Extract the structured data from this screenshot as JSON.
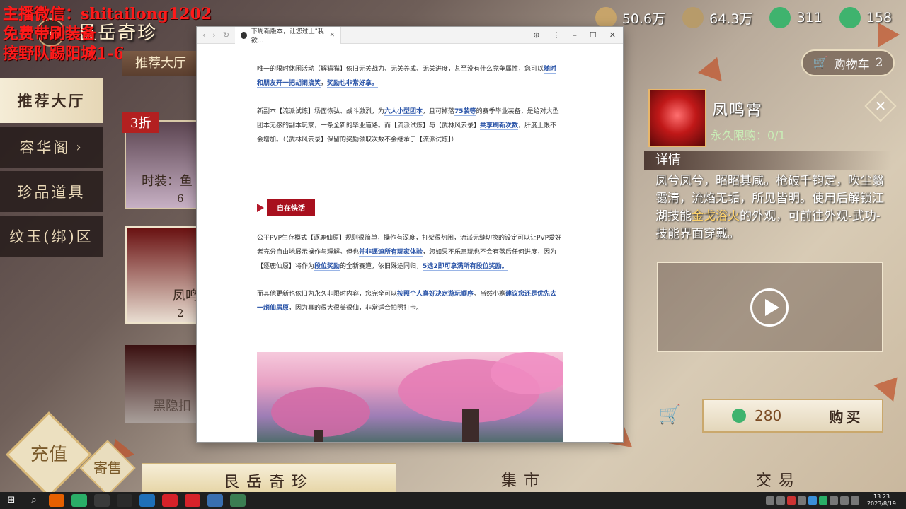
{
  "overlay": {
    "line1": "主播微信：shitailong1202",
    "line2": "免费带刷装备",
    "line3": "接野队踢阳城1-6"
  },
  "header": {
    "back_icon": "back-arrow-icon",
    "title": "艮岳奇珍"
  },
  "resources": [
    {
      "icon": "scroll-icon",
      "value": "50.6万",
      "color": "#c7a46a"
    },
    {
      "icon": "coin-icon",
      "value": "64.3万",
      "color": "#b79b6a"
    },
    {
      "icon": "jade-icon",
      "value": "311",
      "color": "#3fb36e"
    },
    {
      "icon": "jade-bound-icon",
      "value": "158",
      "color": "#3fb36e"
    }
  ],
  "cart": {
    "label": "购物车",
    "count": "2"
  },
  "side_nav": [
    {
      "label": "推荐大厅",
      "active": true
    },
    {
      "label": "容华阁",
      "chevron": "›"
    },
    {
      "label": "珍品道具"
    },
    {
      "label": "纹玉(绑)区"
    }
  ],
  "sub_tab": "推荐大厅",
  "cards": {
    "discount": "3折",
    "card1_label": "时装：鱼",
    "card1_price": "6",
    "card2_label": "凤鸣",
    "card2_price": "2",
    "card3_label": "黑隐扣"
  },
  "item": {
    "name": "凤鸣霄",
    "limit": "永久限购：0/1",
    "detail_head": "详情",
    "desc_1": "凤兮凤兮，昭昭其咸。枪破千钧定，吹尘翳霭清，流焰无垢，所见皆明。使用后解锁江湖技能",
    "desc_gold": "金戈浴火",
    "desc_2": "的外观，可前往外观-武功-技能界面穿戴。",
    "price": "280",
    "buy_label": "购买"
  },
  "bottom_tabs": [
    {
      "label": "艮岳奇珍",
      "active": true
    },
    {
      "label": "集市"
    },
    {
      "label": "交易"
    }
  ],
  "corner": {
    "recharge": "充值",
    "consign": "寄售"
  },
  "browser": {
    "tab_title": "下周新版本，让您过上\"我欲...",
    "p1_a": "唯一的限时休闲活动【解猫猫】依旧无关战力、无关养成、无关进度，甚至没有什么竞争属性，您可以",
    "p1_b": "随时和朋友开一把胡闹搞笑",
    "p1_c": "，",
    "p1_d": "奖励也非常好拿。",
    "p2_a": "新副本【流派试炼】场面恢弘、战斗激烈，为",
    "p2_b": "六人小型团本",
    "p2_c": "，且可掉落",
    "p2_d": "75装等",
    "p2_e": "的赛季毕业装备，是给对大型团本无感的副本玩家，一条全新的毕业道路。而【流派试炼】与【武林风云录】",
    "p2_f": "共享刷新次数",
    "p2_g": "，肝度上限不会增加。（【武林风云录】保留的奖励领取次数不会继承于【流派试炼】）",
    "section": "自在快活",
    "p3_a": "公平PVP生存模式【逐鹿仙原】规则很简单，操作有深度，打架很热闹，流派无缝切换的设定可以让PVP爱好者充分自由地展示操作与理解。但也",
    "p3_b": "并非逼迫所有玩家体验",
    "p3_c": "，您如果不乐意玩也不会有落后任何进度，因为【逐鹿仙原】将作为",
    "p3_d": "段位奖励",
    "p3_e": "的全新赛道，依旧殊途同归，",
    "p3_f": "5选2即可拿满所有段位奖励。",
    "p4_a": "而其他更新也依旧为永久非限时内容，您完全可以",
    "p4_b": "按照个人喜好决定游玩顺序",
    "p4_c": "。当然小寒",
    "p4_d": "建议您还是优先去一趟仙居原",
    "p4_e": "，因为真的很大很美很仙，非常适合拍照打卡。"
  },
  "taskbar": {
    "time": "13:23",
    "date": "2023/8/19"
  }
}
